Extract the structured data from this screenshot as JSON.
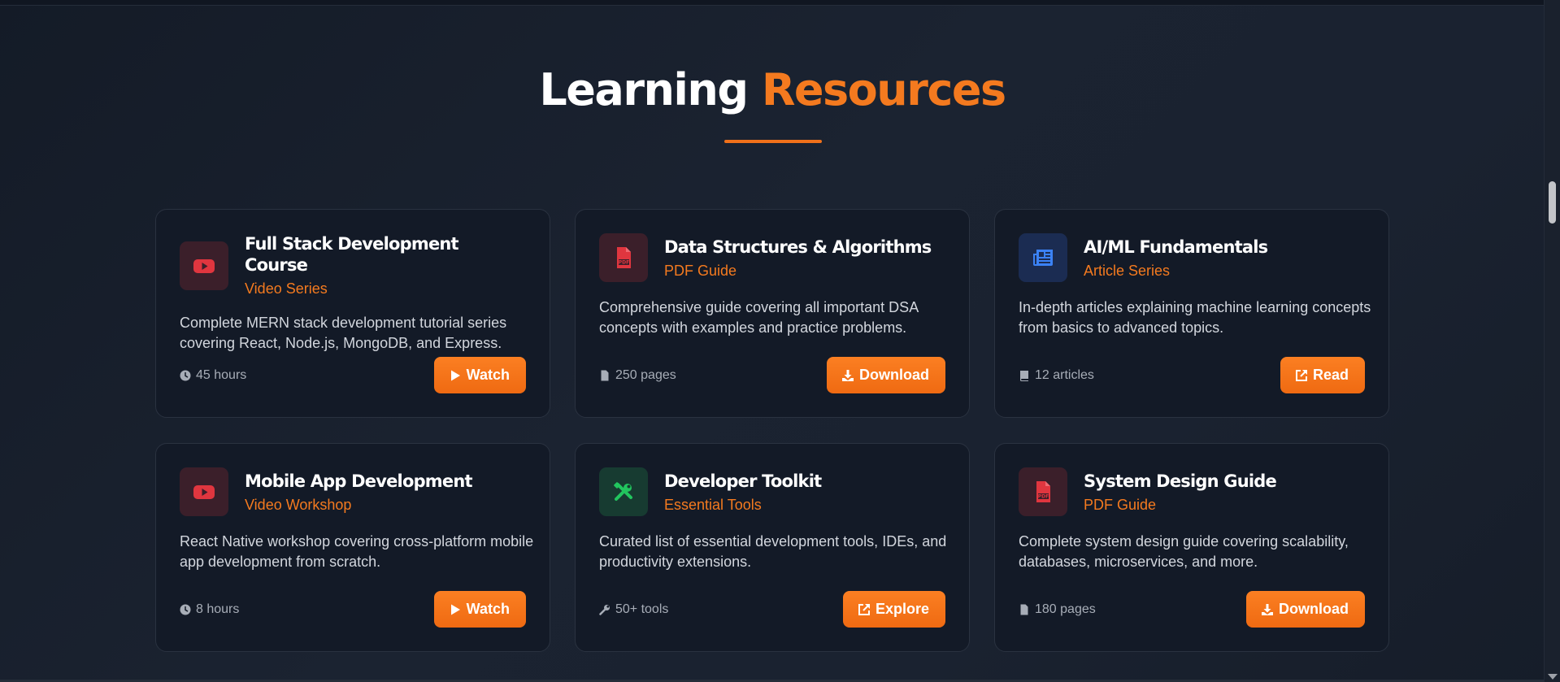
{
  "section": {
    "title_white": "Learning",
    "title_orange": "Resources"
  },
  "colors": {
    "accent": "#f47a1f",
    "background": "#1b2331",
    "card_background": "#131a27"
  },
  "resources": [
    {
      "title": "Full Stack Development Course",
      "type": "Video Series",
      "description": "Complete MERN stack development tutorial series covering React, Node.js, MongoDB, and Express.",
      "meta": "45 hours",
      "meta_icon": "clock-icon",
      "icon": "youtube-icon",
      "button": "Watch",
      "button_icon": "play-icon"
    },
    {
      "title": "Data Structures & Algorithms",
      "type": "PDF Guide",
      "description": "Comprehensive guide covering all important DSA concepts with examples and practice problems.",
      "meta": "250 pages",
      "meta_icon": "file-icon",
      "icon": "pdf-icon",
      "button": "Download",
      "button_icon": "download-icon"
    },
    {
      "title": "AI/ML Fundamentals",
      "type": "Article Series",
      "description": "In-depth articles explaining machine learning concepts from basics to advanced topics.",
      "meta": "12 articles",
      "meta_icon": "book-icon",
      "icon": "newspaper-icon",
      "button": "Read",
      "button_icon": "external-link-icon"
    },
    {
      "title": "Mobile App Development",
      "type": "Video Workshop",
      "description": "React Native workshop covering cross-platform mobile app development from scratch.",
      "meta": "8 hours",
      "meta_icon": "clock-icon",
      "icon": "youtube-icon",
      "button": "Watch",
      "button_icon": "play-icon"
    },
    {
      "title": "Developer Toolkit",
      "type": "Essential Tools",
      "description": "Curated list of essential development tools, IDEs, and productivity extensions.",
      "meta": "50+ tools",
      "meta_icon": "wrench-icon",
      "icon": "tools-icon",
      "button": "Explore",
      "button_icon": "external-link-icon"
    },
    {
      "title": "System Design Guide",
      "type": "PDF Guide",
      "description": "Complete system design guide covering scalability, databases, microservices, and more.",
      "meta": "180 pages",
      "meta_icon": "file-icon",
      "icon": "pdf-icon",
      "button": "Download",
      "button_icon": "download-icon"
    }
  ]
}
